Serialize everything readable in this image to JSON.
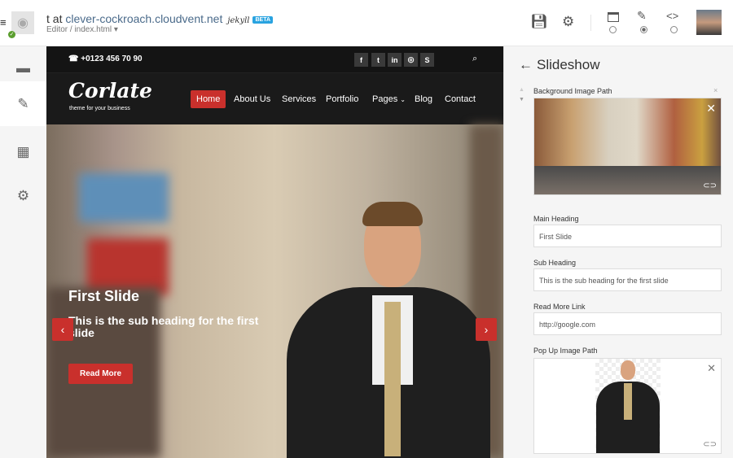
{
  "header": {
    "title_prefix": "t at",
    "domain": "clever-cockroach.cloudvent.net",
    "generator": "jekyll",
    "badge": "BETA",
    "breadcrumb": "Editor / index.html",
    "icons": [
      "menu-icon",
      "site-eye-icon",
      "save-icon",
      "gear-icon",
      "window-icon",
      "pencil-icon",
      "code-icon",
      "avatar"
    ],
    "view_modes": [
      "preview",
      "editor",
      "source"
    ],
    "selected_view": "editor"
  },
  "sidebar": {
    "items": [
      {
        "name": "folder-icon"
      },
      {
        "name": "pencil-icon",
        "active": true
      },
      {
        "name": "calendar-icon"
      },
      {
        "name": "gear-icon"
      }
    ]
  },
  "site": {
    "phone": "+0123 456 70 90",
    "social": [
      "f",
      "t",
      "in",
      "dribbble",
      "skype"
    ],
    "logo": "Corlate",
    "tagline": "theme for your business",
    "nav": [
      "Home",
      "About Us",
      "Services",
      "Portfolio",
      "Pages",
      "Blog",
      "Contact"
    ],
    "active_nav": "Home",
    "slide": {
      "heading": "First Slide",
      "subheading": "This is the sub heading for the first slide",
      "button": "Read More"
    }
  },
  "panel": {
    "title": "Slideshow",
    "fields": {
      "bg_label": "Background Image Path",
      "main_label": "Main Heading",
      "main_value": "First Slide",
      "sub_label": "Sub Heading",
      "sub_value": "This is the sub heading for the first slide",
      "link_label": "Read More Link",
      "link_value": "http://google.com",
      "popup_label": "Pop Up Image Path"
    }
  },
  "colors": {
    "accent": "#c9302c",
    "beta": "#29a3e0"
  }
}
